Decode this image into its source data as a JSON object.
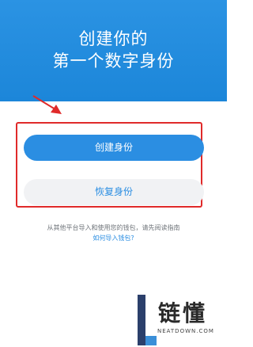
{
  "hero": {
    "line1": "创建你的",
    "line2": "第一个数字身份"
  },
  "actions": {
    "create_label": "创建身份",
    "restore_label": "恢复身份"
  },
  "import": {
    "note": "从其他平台导入和使用您的钱包，请先阅读指南",
    "link": "如何导入钱包?"
  },
  "watermark": {
    "name": "链懂",
    "domain": "NEATDOWN.COM"
  },
  "colors": {
    "brand_blue": "#2b8ee2",
    "highlight_red": "#e02a2a"
  }
}
